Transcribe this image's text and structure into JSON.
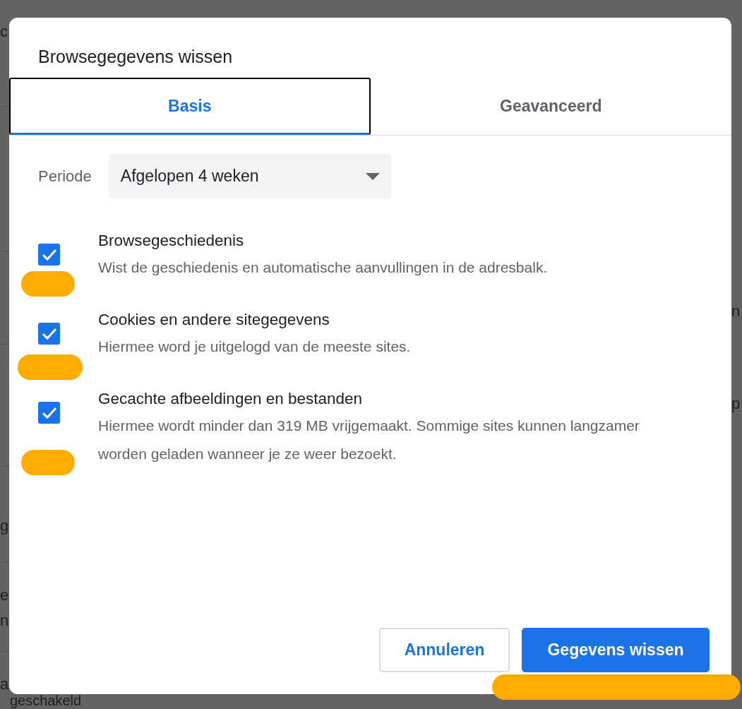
{
  "background_page": {
    "left_fragments": [
      "c",
      "g",
      "e",
      "n",
      "a",
      "geschakeld"
    ],
    "right_fragments": [
      "n",
      "p"
    ]
  },
  "dialog": {
    "title": "Browsegegevens wissen",
    "tabs": [
      {
        "label": "Basis",
        "selected": true
      },
      {
        "label": "Geavanceerd",
        "selected": false
      }
    ],
    "period": {
      "label": "Periode",
      "value": "Afgelopen 4 weken"
    },
    "options": [
      {
        "title": "Browsegeschiedenis",
        "description": "Wist de geschiedenis en automatische aanvullingen in de adresbalk.",
        "checked": true
      },
      {
        "title": "Cookies en andere sitegegevens",
        "description": "Hiermee word je uitgelogd van de meeste sites.",
        "checked": true
      },
      {
        "title": "Gecachte afbeeldingen en bestanden",
        "description": "Hiermee wordt minder dan 319 MB vrijgemaakt. Sommige sites kunnen langzamer worden geladen wanneer je ze weer bezoekt.",
        "checked": true
      }
    ],
    "buttons": [
      {
        "label": "Annuleren",
        "kind": "secondary"
      },
      {
        "label": "Gegevens wissen",
        "kind": "primary"
      }
    ]
  }
}
